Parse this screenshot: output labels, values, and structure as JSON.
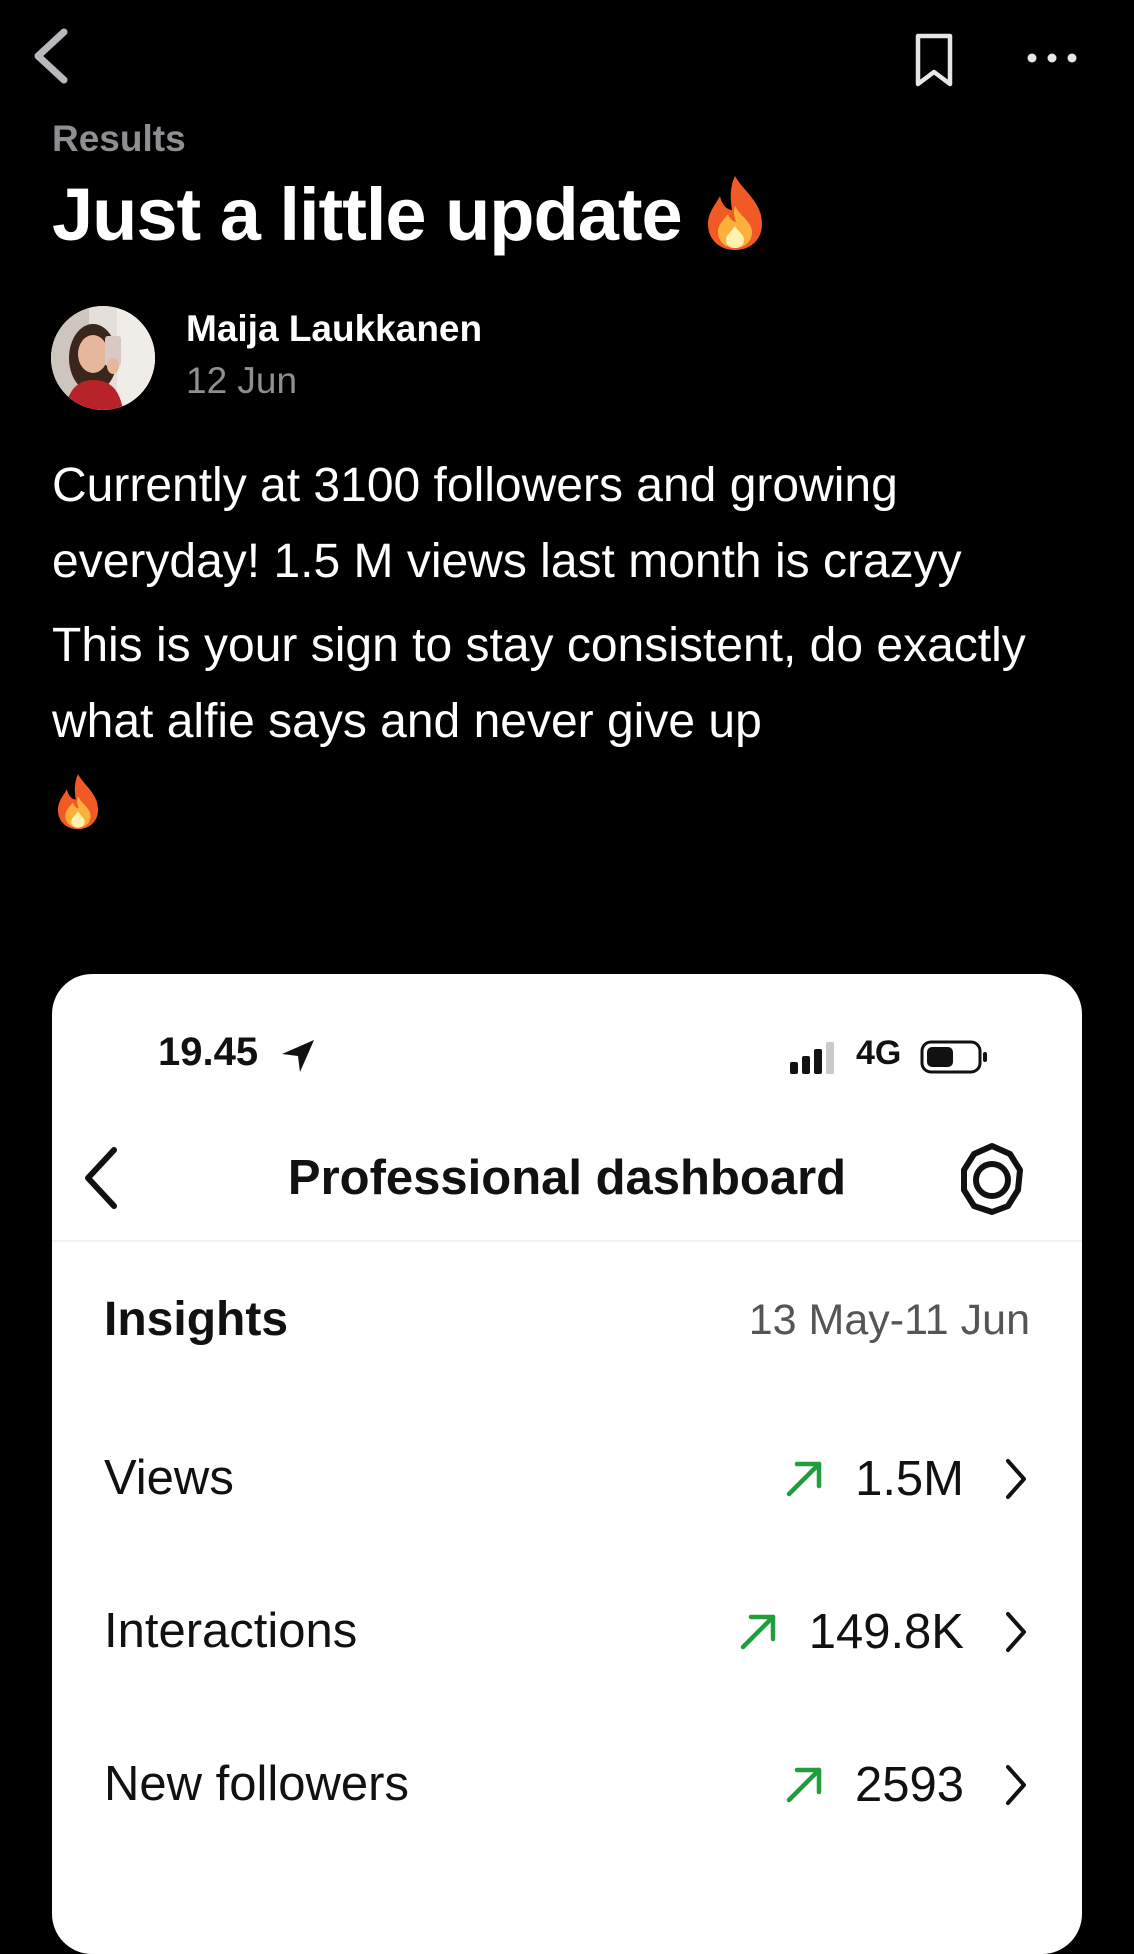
{
  "topbar": {
    "back_icon": "chevron-left-icon",
    "bookmark_icon": "bookmark-icon",
    "more_icon": "more-horizontal-icon"
  },
  "post": {
    "breadcrumb": "Results",
    "title": "Just a little update",
    "title_emoji": "fire",
    "author": {
      "name": "Maija Laukkanen",
      "date": "12 Jun"
    },
    "paragraphs": [
      "Currently at 3100 followers and growing everyday! 1.5 M views last month is crazyy",
      "This is your sign to stay consistent, do exactly what alfie says and never give up"
    ],
    "trailing_emoji": "fire"
  },
  "screenshot": {
    "status_bar": {
      "time": "19.45",
      "network": "4G"
    },
    "header": {
      "title": "Professional dashboard"
    },
    "insights": {
      "label": "Insights",
      "range": "13 May-11 Jun"
    },
    "metrics": [
      {
        "label": "Views",
        "value": "1.5M",
        "trend": "up"
      },
      {
        "label": "Interactions",
        "value": "149.8K",
        "trend": "up"
      },
      {
        "label": "New followers",
        "value": "2593",
        "trend": "up"
      }
    ]
  },
  "colors": {
    "background": "#000000",
    "muted_text": "#8e8e93",
    "card_background": "#ffffff",
    "trend_green": "#1f9e3b"
  }
}
